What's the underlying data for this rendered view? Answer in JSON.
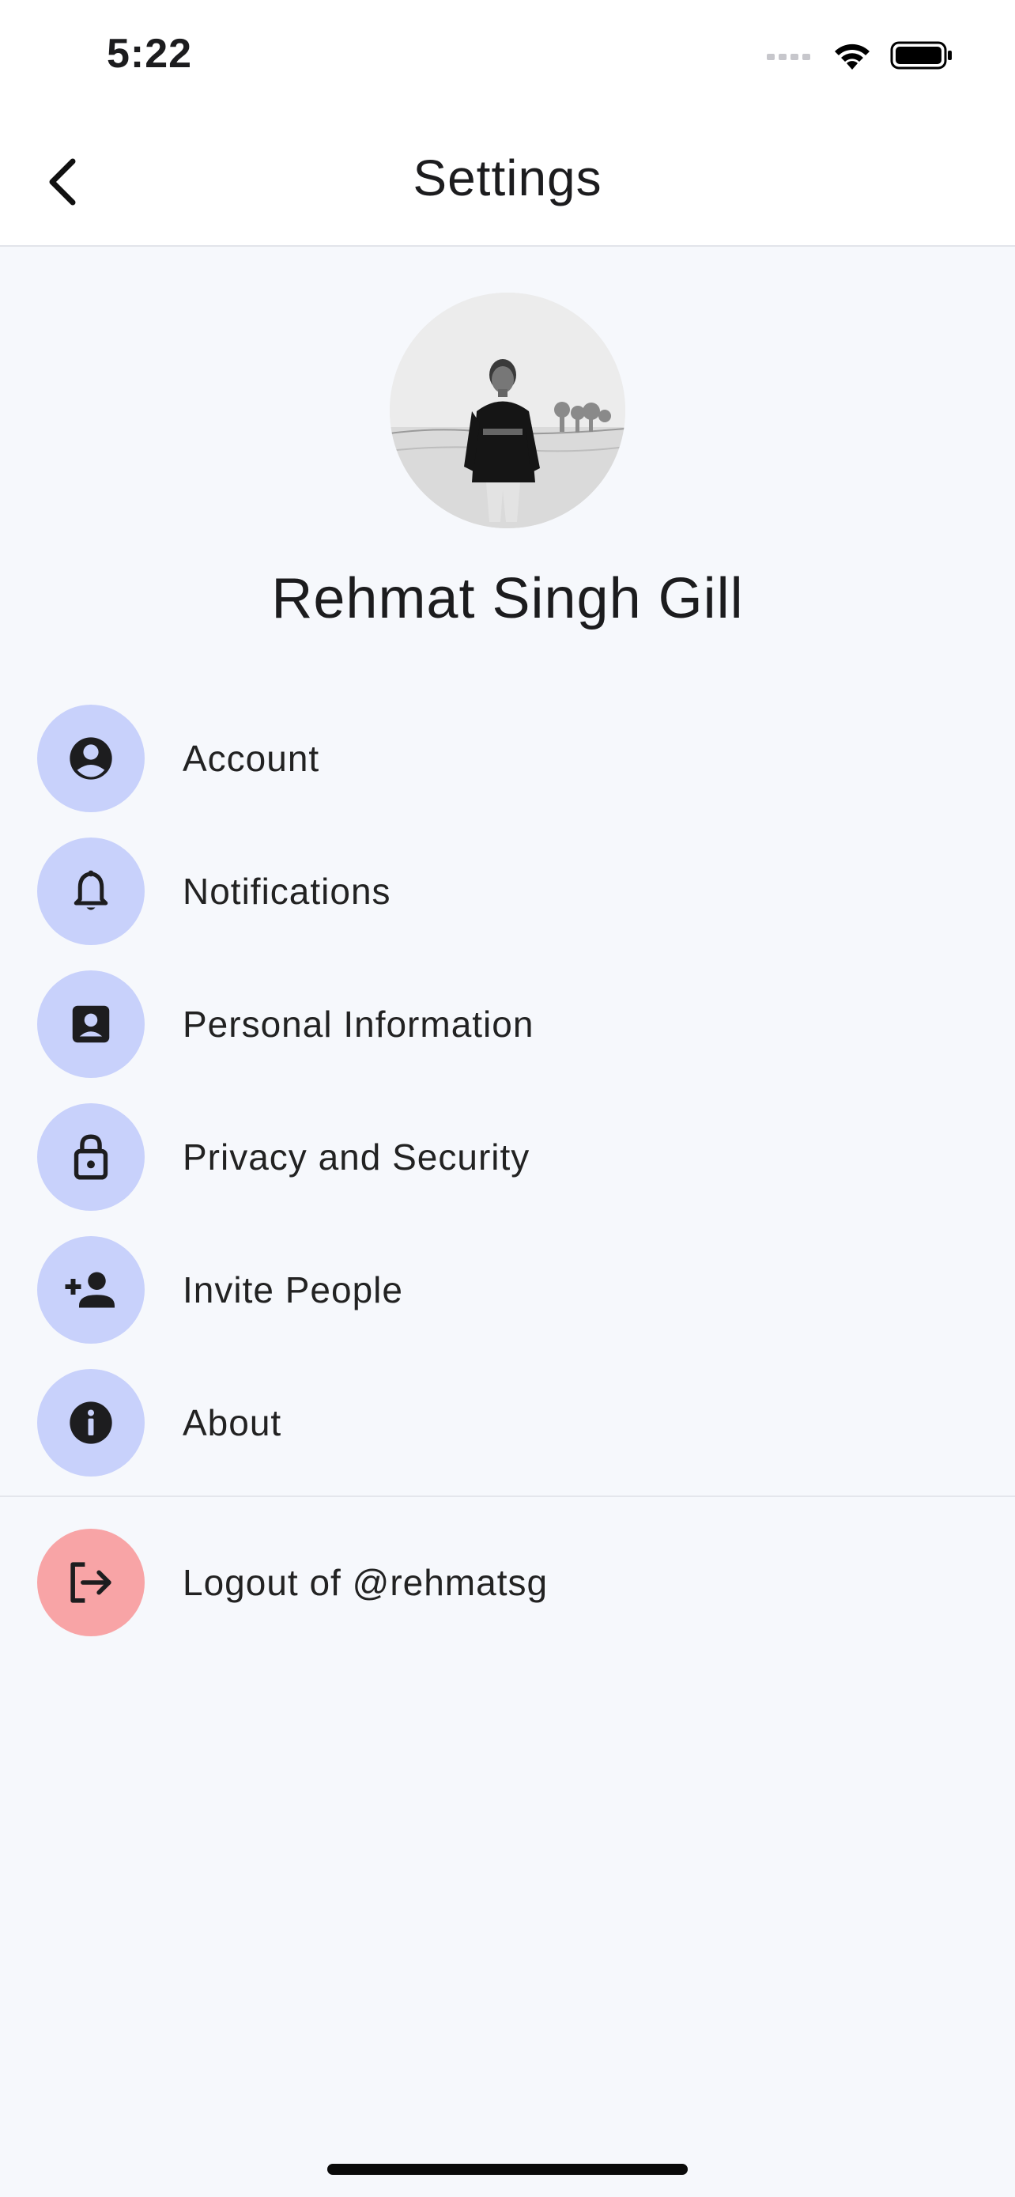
{
  "status_bar": {
    "time": "5:22",
    "icons": [
      "signal-icon",
      "wifi-icon",
      "battery-icon"
    ]
  },
  "nav": {
    "title": "Settings",
    "back_icon": "chevron-left-icon"
  },
  "profile": {
    "name": "Rehmat Singh Gill"
  },
  "menu": {
    "items": [
      {
        "label": "Account",
        "icon": "account-circle-icon"
      },
      {
        "label": "Notifications",
        "icon": "bell-icon"
      },
      {
        "label": "Personal Information",
        "icon": "contact-card-icon"
      },
      {
        "label": "Privacy and Security",
        "icon": "lock-icon"
      },
      {
        "label": "Invite People",
        "icon": "person-add-icon"
      },
      {
        "label": "About",
        "icon": "info-icon"
      }
    ],
    "logout": {
      "label": "Logout of @rehmatsg",
      "icon": "logout-icon"
    }
  },
  "colors": {
    "background": "#f6f8fc",
    "icon_circle": "#c8d1fb",
    "logout_circle": "#f8a4a6"
  }
}
